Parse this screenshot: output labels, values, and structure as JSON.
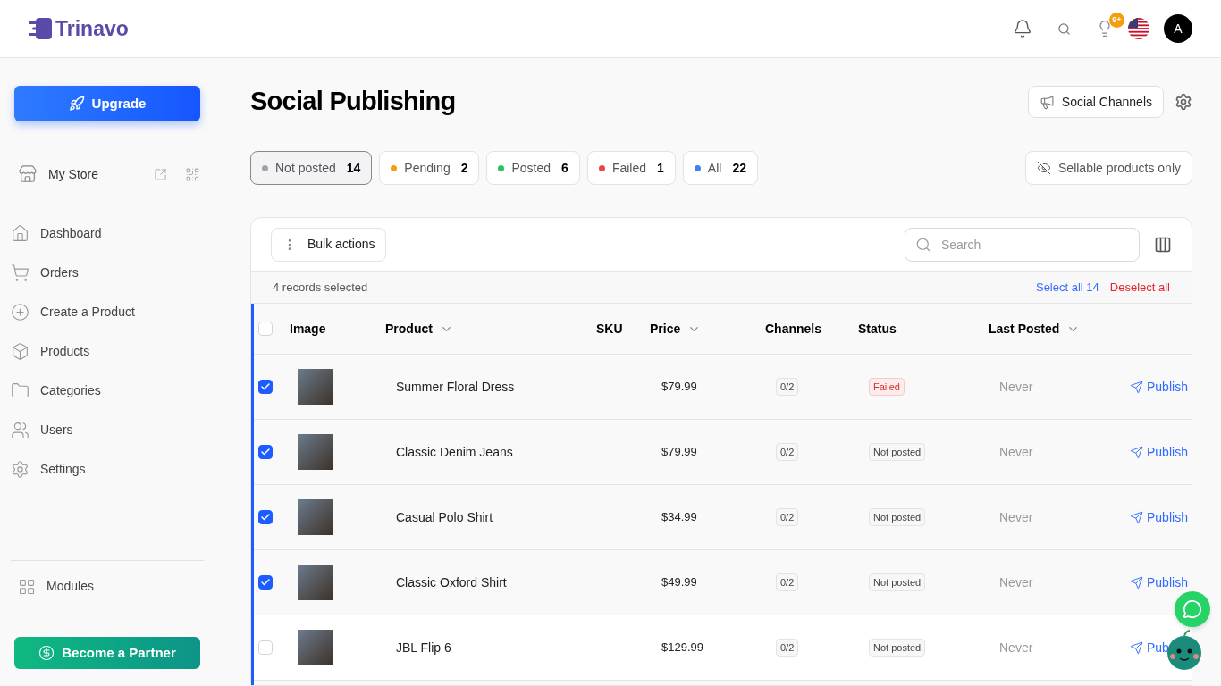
{
  "header": {
    "logo": "Trinavo",
    "notifications_badge": "9+",
    "avatar": "A"
  },
  "sidebar": {
    "upgrade": "Upgrade",
    "store": "My Store",
    "items": [
      {
        "label": "Dashboard"
      },
      {
        "label": "Orders"
      },
      {
        "label": "Create a Product"
      },
      {
        "label": "Products"
      },
      {
        "label": "Categories"
      },
      {
        "label": "Users"
      },
      {
        "label": "Settings"
      }
    ],
    "modules": "Modules",
    "partner": "Become a Partner"
  },
  "page": {
    "title": "Social Publishing",
    "channels_button": "Social Channels",
    "filters": [
      {
        "label": "Not posted",
        "count": "14",
        "color": "#9ca3af",
        "selected": true
      },
      {
        "label": "Pending",
        "count": "2",
        "color": "#f59e0b",
        "selected": false
      },
      {
        "label": "Posted",
        "count": "6",
        "color": "#22c55e",
        "selected": false
      },
      {
        "label": "Failed",
        "count": "1",
        "color": "#ef4444",
        "selected": false
      },
      {
        "label": "All",
        "count": "22",
        "color": "#3b82f6",
        "selected": false
      }
    ],
    "sellable_toggle": "Sellable products only"
  },
  "table": {
    "bulk_actions": "Bulk actions",
    "search": {
      "placeholder": "Search"
    },
    "selection": {
      "text": "4 records selected",
      "select_all": "Select all 14",
      "deselect_all": "Deselect all"
    },
    "header_checked": false,
    "columns": [
      {
        "label": "Image",
        "sortable": false
      },
      {
        "label": "Product",
        "sortable": true
      },
      {
        "label": "SKU",
        "sortable": false
      },
      {
        "label": "Price",
        "sortable": true
      },
      {
        "label": "Channels",
        "sortable": false
      },
      {
        "label": "Status",
        "sortable": false
      },
      {
        "label": "Last Posted",
        "sortable": true
      }
    ],
    "rows": [
      {
        "checked": true,
        "product": "Summer Floral Dress",
        "price": "$79.99",
        "channels": "0/2",
        "status": "Failed",
        "kind": "failed",
        "last_posted": "Never",
        "action": "Publish"
      },
      {
        "checked": true,
        "product": "Classic Denim Jeans",
        "price": "$79.99",
        "channels": "0/2",
        "status": "Not posted",
        "kind": "not_posted",
        "last_posted": "Never",
        "action": "Publish"
      },
      {
        "checked": true,
        "product": "Casual Polo Shirt",
        "price": "$34.99",
        "channels": "0/2",
        "status": "Not posted",
        "kind": "not_posted",
        "last_posted": "Never",
        "action": "Publish"
      },
      {
        "checked": true,
        "product": "Classic Oxford Shirt",
        "price": "$49.99",
        "channels": "0/2",
        "status": "Not posted",
        "kind": "not_posted",
        "last_posted": "Never",
        "action": "Publish"
      },
      {
        "checked": false,
        "product": "JBL Flip 6",
        "price": "$129.99",
        "channels": "0/2",
        "status": "Not posted",
        "kind": "not_posted",
        "last_posted": "Never",
        "action": "Pub"
      }
    ]
  }
}
